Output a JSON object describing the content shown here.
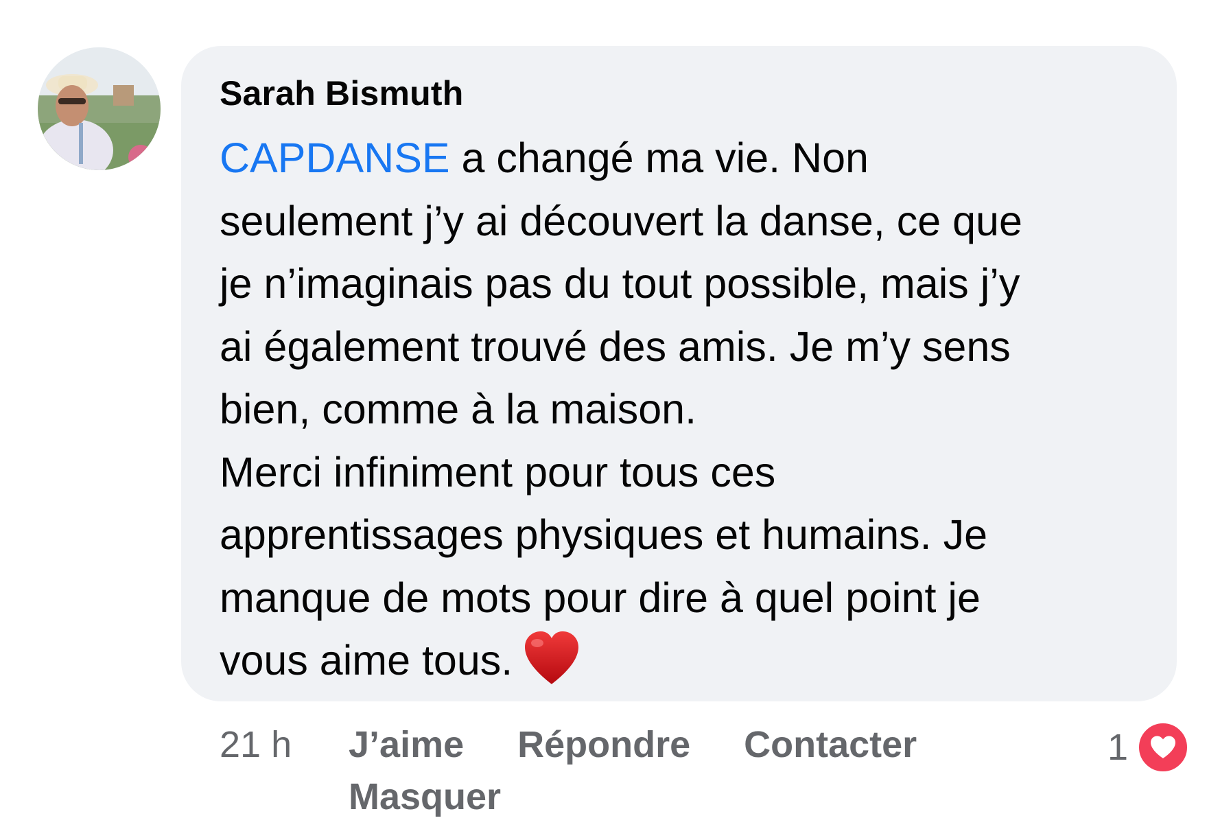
{
  "comment": {
    "author": "Sarah Bismuth",
    "mention": "CAPDANSE",
    "lines": [
      " a changé ma vie. Non",
      "seulement j’y ai découvert la danse, ce que",
      "je n’imaginais pas du tout possible, mais j’y",
      "ai également trouvé des amis. Je m’y sens",
      "bien, comme à la maison.",
      "Merci infiniment pour tous ces",
      "apprentissages physiques et humains. Je",
      "manque de mots pour dire à quel point je",
      "vous aime tous."
    ],
    "emoji": "red-heart"
  },
  "actions": {
    "timestamp": "21 h",
    "like_label": "J’aime",
    "reply_label": "Répondre",
    "contact_label": "Contacter",
    "hide_label": "Masquer"
  },
  "reactions": {
    "count": "1",
    "icon": "love-reaction-icon",
    "icon_color": "#f33e58"
  },
  "colors": {
    "mention": "#1877f2",
    "bubble": "#f0f2f5",
    "secondary_text": "#65676b"
  }
}
